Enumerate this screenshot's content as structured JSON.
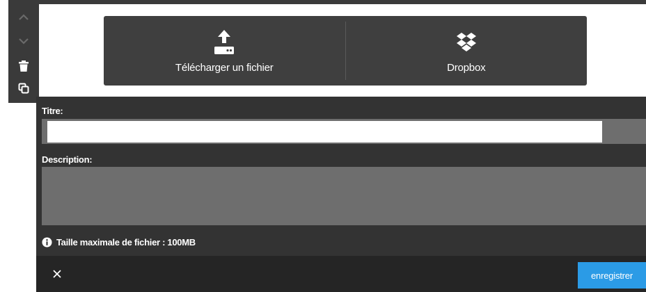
{
  "toolbar": {
    "items": [
      {
        "icon": "chevron-up-icon"
      },
      {
        "icon": "chevron-down-icon"
      },
      {
        "icon": "trash-icon"
      },
      {
        "icon": "duplicate-icon"
      }
    ]
  },
  "upload_sources": [
    {
      "label": "Télécharger un fichier",
      "icon": "upload-icon"
    },
    {
      "label": "Dropbox",
      "icon": "dropbox-icon"
    }
  ],
  "form": {
    "title_label": "Titre:",
    "title_value": "",
    "description_label": "Description:",
    "description_value": "",
    "info_text": "Taille maximale de fichier : 100MB",
    "info_icon": "info-icon"
  },
  "footer": {
    "close_icon": "close-icon",
    "save_label": "enregistrer"
  },
  "colors": {
    "dark_panel": "#3f3f3f",
    "form_bg": "#333333",
    "footer_bg": "#252525",
    "input_gray": "#6e6e6e",
    "accent": "#2b9be6"
  }
}
